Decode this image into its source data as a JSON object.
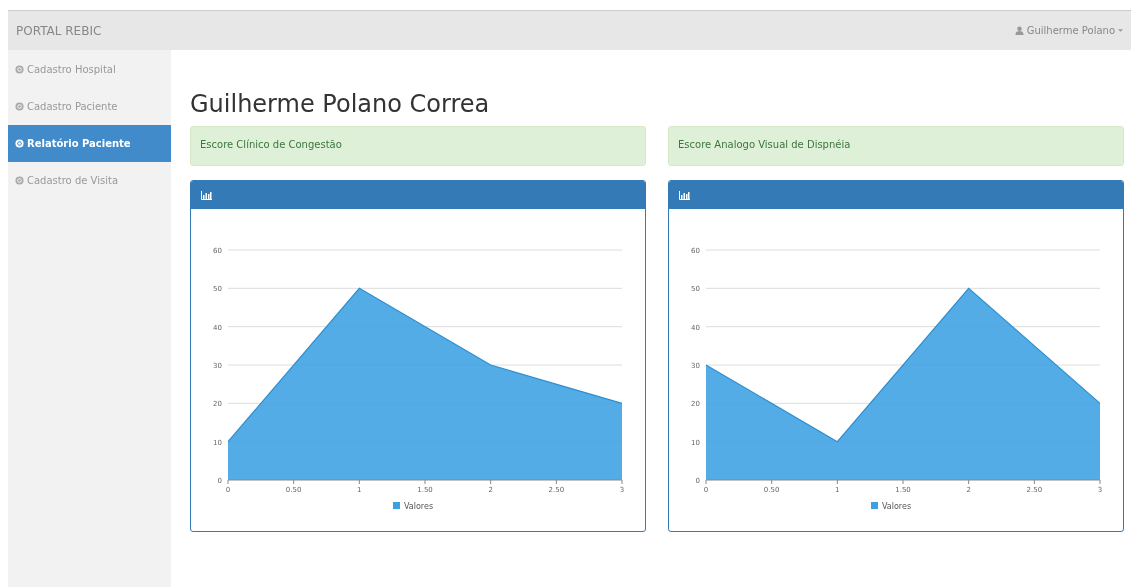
{
  "navbar": {
    "brand": "PORTAL REBIC",
    "user": "Guilherme Polano"
  },
  "sidebar": {
    "items": [
      {
        "label": "Cadastro Hospital",
        "selected": false
      },
      {
        "label": "Cadastro Paciente",
        "selected": false
      },
      {
        "label": "Relatório Paciente",
        "selected": true
      },
      {
        "label": "Cadastro de Visita",
        "selected": false
      }
    ]
  },
  "page_title": "Guilherme Polano Correa",
  "panels": [
    {
      "heading": "Escore Clínico de Congestão",
      "chart_data": {
        "type": "area",
        "grid": true,
        "x": [
          0,
          1,
          2,
          3
        ],
        "series": [
          {
            "name": "Valores",
            "color": "#3ba1e2",
            "values": [
              10,
              50,
              30,
              20
            ]
          }
        ],
        "xlim": [
          0,
          3
        ],
        "ylim": [
          0,
          60
        ],
        "xticks": [
          0,
          {
            "value": 0.5,
            "label": "0.50"
          },
          1,
          {
            "value": 1.5,
            "label": "1.50"
          },
          2,
          {
            "value": 2.5,
            "label": "2.50"
          },
          3
        ],
        "yticks": [
          0,
          10,
          20,
          30,
          40,
          50,
          60
        ]
      }
    },
    {
      "heading": "Escore Analogo Visual de Dispnéia",
      "chart_data": {
        "type": "area",
        "grid": true,
        "x": [
          0,
          1,
          2,
          3
        ],
        "series": [
          {
            "name": "Valores",
            "color": "#3ba1e2",
            "values": [
              30,
              10,
              50,
              20
            ]
          }
        ],
        "xlim": [
          0,
          3
        ],
        "ylim": [
          0,
          60
        ],
        "xticks": [
          0,
          {
            "value": 0.5,
            "label": "0.50"
          },
          1,
          {
            "value": 1.5,
            "label": "1.50"
          },
          2,
          {
            "value": 2.5,
            "label": "2.50"
          },
          3
        ],
        "yticks": [
          0,
          10,
          20,
          30,
          40,
          50,
          60
        ]
      }
    }
  ]
}
